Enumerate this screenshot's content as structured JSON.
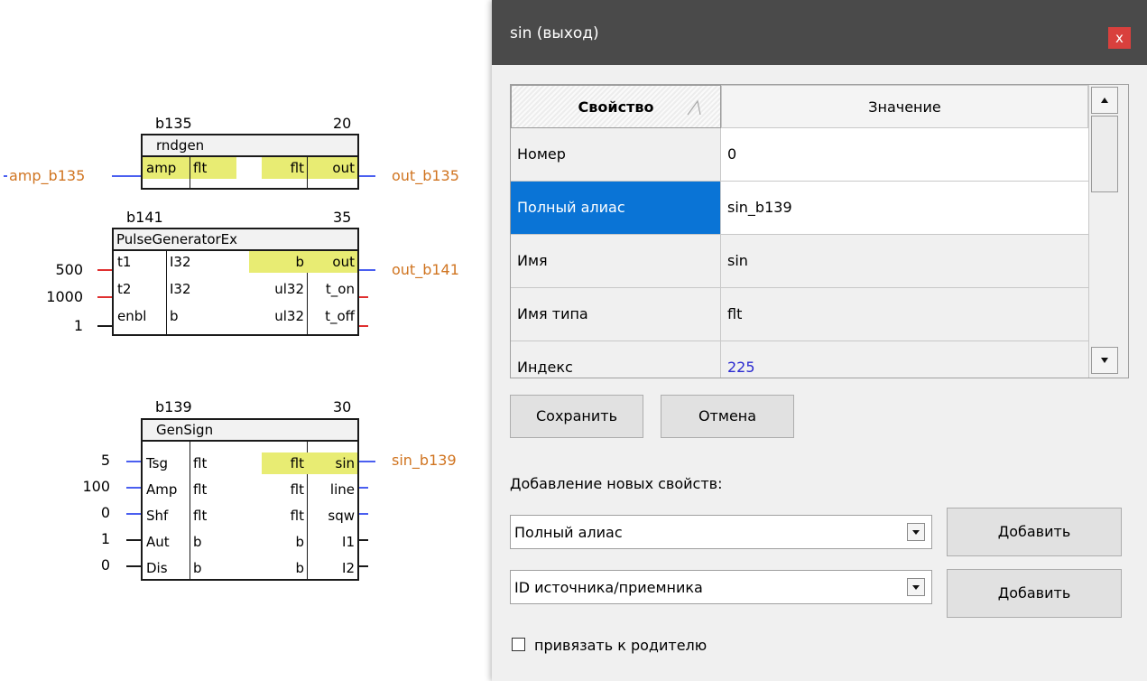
{
  "diagram": {
    "b135": {
      "id": "b135",
      "priority": "20",
      "name": "rndgen",
      "in_name": "amp",
      "in_type": "flt",
      "out_type": "flt",
      "out_name": "out",
      "in_signal": "amp_b135",
      "out_signal": "out_b135"
    },
    "b141": {
      "id": "b141",
      "priority": "35",
      "name": "PulseGeneratorEx",
      "rows": [
        {
          "ext": "500",
          "in_name": "t1",
          "in_type": "I32",
          "out_type": "b",
          "out_name": "out"
        },
        {
          "ext": "1000",
          "in_name": "t2",
          "in_type": "I32",
          "out_type": "ul32",
          "out_name": "t_on"
        },
        {
          "ext": "1",
          "in_name": "enbl",
          "in_type": "b",
          "out_type": "ul32",
          "out_name": "t_off"
        }
      ],
      "out_signal": "out_b141"
    },
    "b139": {
      "id": "b139",
      "priority": "30",
      "name": "GenSign",
      "rows": [
        {
          "ext": "5",
          "in_name": "Tsg",
          "in_type": "flt",
          "out_type": "flt",
          "out_name": "sin"
        },
        {
          "ext": "100",
          "in_name": "Amp",
          "in_type": "flt",
          "out_type": "flt",
          "out_name": "line"
        },
        {
          "ext": "0",
          "in_name": "Shf",
          "in_type": "flt",
          "out_type": "flt",
          "out_name": "sqw"
        },
        {
          "ext": "1",
          "in_name": "Aut",
          "in_type": "b",
          "out_type": "b",
          "out_name": "I1"
        },
        {
          "ext": "0",
          "in_name": "Dis",
          "in_type": "b",
          "out_type": "b",
          "out_name": "I2"
        }
      ],
      "out_signal": "sin_b139"
    }
  },
  "dialog": {
    "title": "sin (выход)",
    "close_label": "x",
    "grid": {
      "header_property": "Свойство",
      "header_value": "Значение",
      "rows": [
        {
          "key": "Номер",
          "value": "0"
        },
        {
          "key": "Полный алиас",
          "value": "sin_b139"
        },
        {
          "key": "Имя",
          "value": "sin"
        },
        {
          "key": "Имя типа",
          "value": "flt"
        },
        {
          "key": "Индекс",
          "value": "225"
        }
      ]
    },
    "save_label": "Сохранить",
    "cancel_label": "Отмена",
    "add_section_label": "Добавление новых свойств:",
    "combo1_value": "Полный алиас",
    "combo2_value": "ID источника/приемника",
    "add_label": "Добавить",
    "checkbox_label": "привязать к родителю",
    "colors": {
      "titlebar": "#4a4a4a",
      "close": "#d9403d",
      "selection": "#0a74d6",
      "highlight": "#e8ec73",
      "signal": "#d07420"
    }
  }
}
